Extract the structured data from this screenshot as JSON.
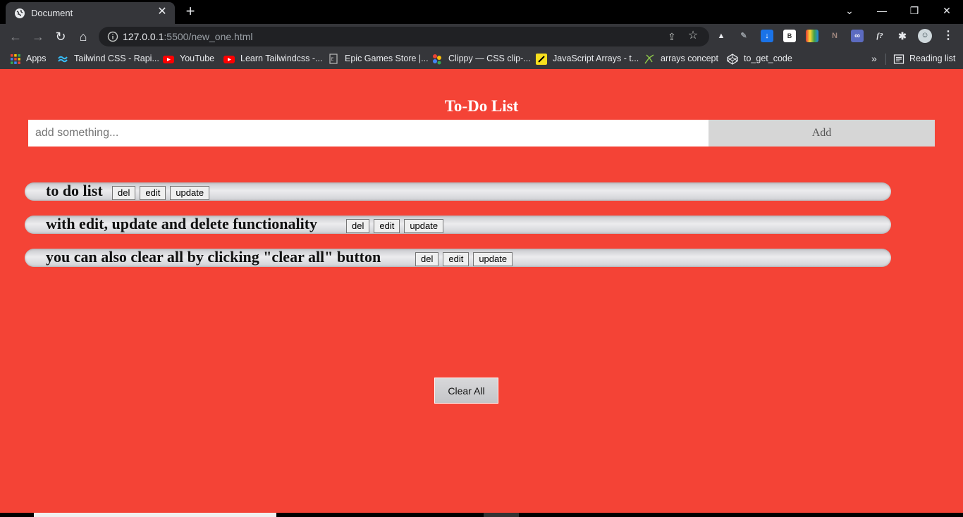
{
  "browser": {
    "tab_title": "Document",
    "tab_close": "✕",
    "new_tab": "+",
    "url_host": "127.0.0.1",
    "url_rest": ":5500/new_one.html",
    "window_controls": {
      "chevron": "⌄",
      "minimize": "—",
      "restore": "❐",
      "close": "✕"
    }
  },
  "bookmarks": {
    "apps": "Apps",
    "items": [
      "Tailwind CSS - Rapi...",
      "YouTube",
      "Learn Tailwindcss -...",
      "Epic Games Store |...",
      "Clippy — CSS clip-...",
      "JavaScript Arrays - t...",
      "arrays concept",
      "to_get_code"
    ],
    "overflow": "»",
    "reading_list": "Reading list"
  },
  "page": {
    "title": "To-Do List",
    "input_placeholder": "add something...",
    "add_label": "Add",
    "todos": [
      {
        "text": "to do list"
      },
      {
        "text": "with edit, update and delete functionality"
      },
      {
        "text": "you can also clear all by clicking \"clear all\" button"
      }
    ],
    "del_label": "del",
    "edit_label": "edit",
    "update_label": "update",
    "clear_all_label": "Clear All"
  },
  "colors": {
    "background": "#f44336",
    "chrome_dark": "#35363a",
    "item_pill": "#e0e1e4"
  }
}
